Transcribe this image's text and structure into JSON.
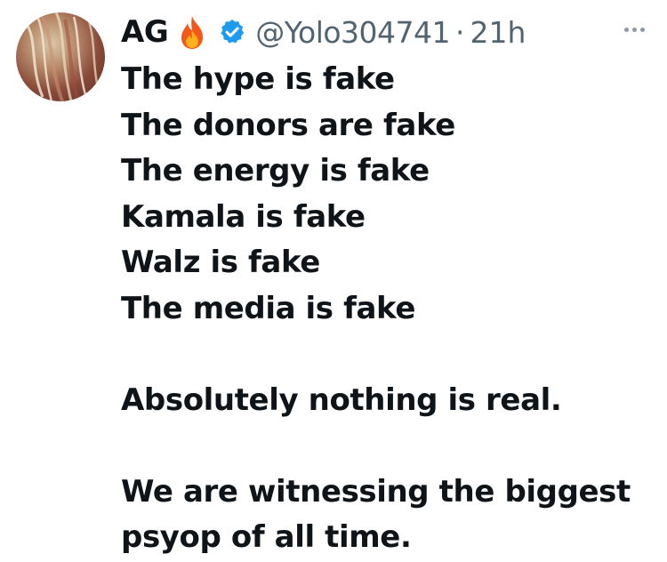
{
  "tweet": {
    "author": {
      "display_name": "AG",
      "name_emoji": "fire-icon",
      "verified_badge": "verified-icon",
      "handle": "@Yolo304741",
      "separator": "·",
      "time": "21h"
    },
    "more_icon": "more-horizontal-icon",
    "colors": {
      "text": "#0f1419",
      "secondary_text": "#536471",
      "verified_blue": "#1d9bf0"
    },
    "lines": [
      "The hype is fake",
      "The donors are fake",
      "The energy is fake",
      "Kamala is fake",
      "Walz is fake",
      "The media is fake",
      "",
      "Absolutely nothing is real.",
      "",
      "We are witnessing the biggest",
      "psyop of all time."
    ]
  }
}
